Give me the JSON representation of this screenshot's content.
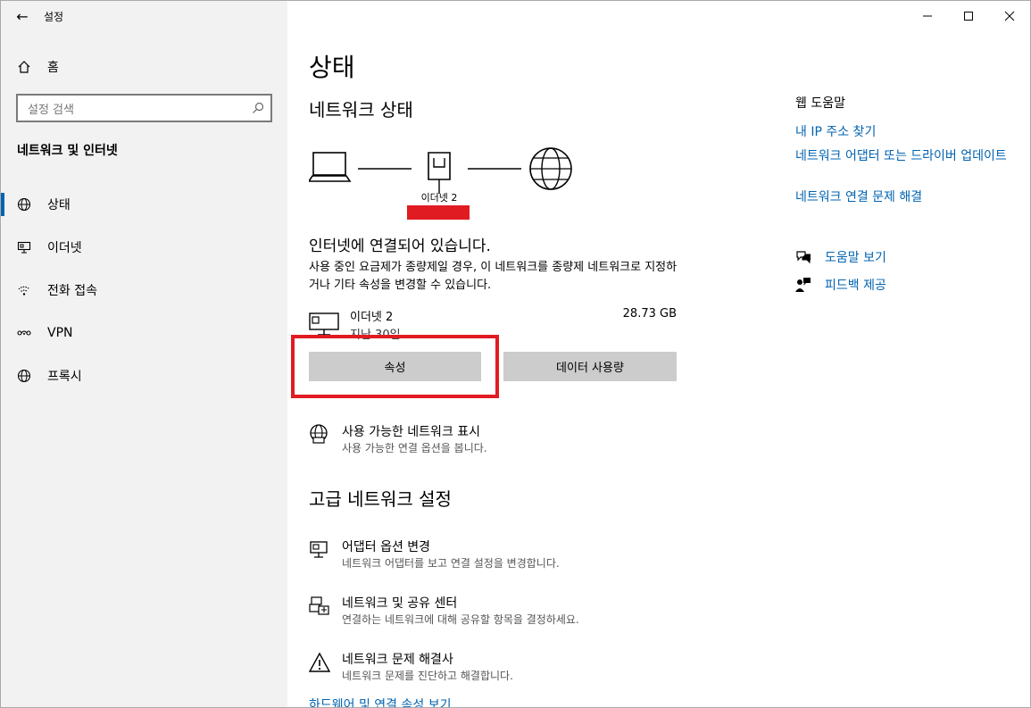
{
  "window": {
    "title": "설정",
    "back_glyph": "←",
    "minimize_glyph": "—",
    "maximize_glyph": "☐",
    "close_glyph": "✕"
  },
  "sidebar": {
    "home_label": "홈",
    "search_placeholder": "설정 검색",
    "section_title": "네트워크 및 인터넷",
    "items": [
      {
        "label": "상태",
        "icon": "status-globe-icon",
        "active": true
      },
      {
        "label": "이더넷",
        "icon": "ethernet-icon",
        "active": false
      },
      {
        "label": "전화 접속",
        "icon": "dialup-icon",
        "active": false
      },
      {
        "label": "VPN",
        "icon": "vpn-icon",
        "active": false
      },
      {
        "label": "프록시",
        "icon": "proxy-globe-icon",
        "active": false
      }
    ]
  },
  "main": {
    "page_title": "상태",
    "network_status_heading": "네트워크 상태",
    "diagram_label": "이더넷 2",
    "connected_text": "인터넷에 연결되어 있습니다.",
    "connected_desc": "사용 중인 요금제가 종량제일 경우, 이 네트워크를 종량제 네트워크로 지정하거나 기타 속성을 변경할 수 있습니다.",
    "adapter": {
      "name": "이더넷 2",
      "sub": "지난 30일",
      "size": "28.73 GB"
    },
    "properties_button": "속성",
    "data_usage_button": "데이터 사용량",
    "show_networks": {
      "title": "사용 가능한 네트워크 표시",
      "desc": "사용 가능한 연결 옵션을 봅니다."
    },
    "advanced_heading": "고급 네트워크 설정",
    "advanced_items": [
      {
        "title": "어댑터 옵션 변경",
        "desc": "네트워크 어댑터를 보고 연결 설정을 변경합니다."
      },
      {
        "title": "네트워크 및 공유 센터",
        "desc": "연결하는 네트워크에 대해 공유할 항목을 결정하세요."
      },
      {
        "title": "네트워크 문제 해결사",
        "desc": "네트워크 문제를 진단하고 해결합니다."
      }
    ],
    "bottom_link": "하드웨어 및 연결 속성 보기"
  },
  "help": {
    "title": "웹 도움말",
    "links": [
      "내 IP 주소 찾기",
      "네트워크 어댑터 또는 드라이버 업데이트",
      "네트워크 연결 문제 해결"
    ],
    "get_help": "도움말 보기",
    "feedback": "피드백 제공"
  },
  "colors": {
    "accent": "#0063b1",
    "highlight_red": "#e11b22",
    "sidebar_bg": "#f2f2f2",
    "button_bg": "#cccccc"
  }
}
